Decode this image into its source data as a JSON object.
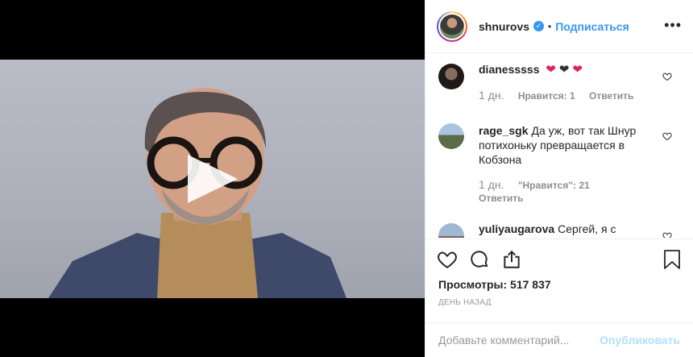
{
  "post": {
    "username": "shnurovs",
    "follow_label": "Подписаться",
    "separator": "•"
  },
  "comments": [
    {
      "user": "dianesssss",
      "text": "",
      "time": "1 дн.",
      "likes": "Нравится: 1",
      "reply": "Ответить"
    },
    {
      "user": "rage_sgk",
      "text": "Да уж, вот так Шнур потихоньку превращается в Кобзона",
      "time": "1 дн.",
      "likes": "\"Нравится\": 21",
      "reply": "Ответить"
    },
    {
      "user": "yuliyaugarova",
      "text": "Сергей, я с",
      "time": "",
      "likes": "",
      "reply": ""
    }
  ],
  "stats": {
    "views": "Просмотры: 517 837",
    "date": "ДЕНЬ НАЗАД"
  },
  "composer": {
    "placeholder": "Добавьте комментарий...",
    "publish": "Опубликовать"
  },
  "colors": {
    "accent": "#3897f0",
    "publish_disabled": "#b2dffc"
  }
}
